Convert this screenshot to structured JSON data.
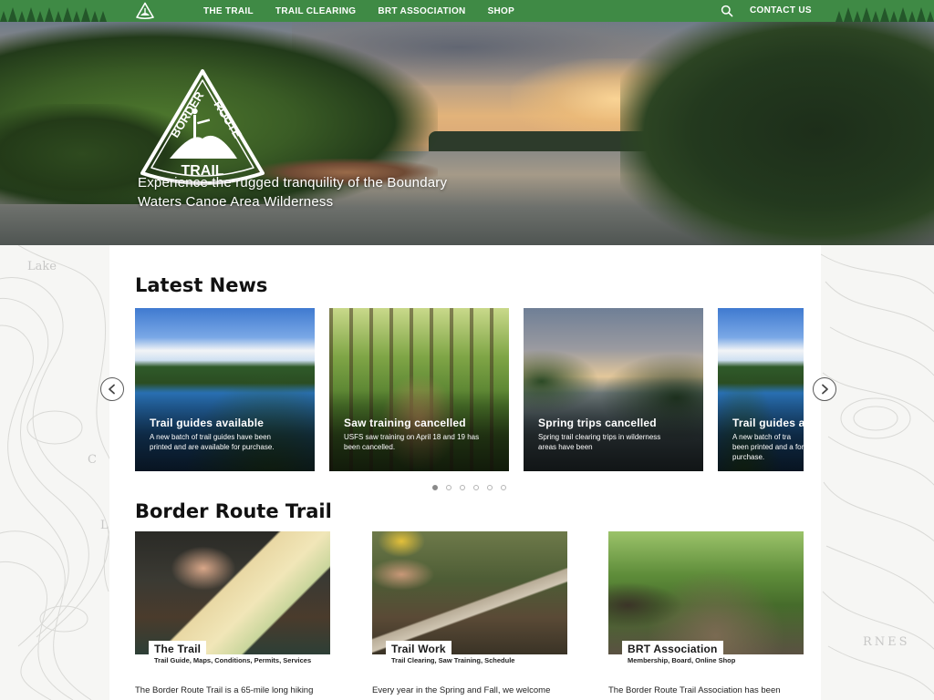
{
  "nav": {
    "links": [
      "THE TRAIL",
      "TRAIL CLEARING",
      "BRT ASSOCIATION",
      "SHOP"
    ],
    "contact": "CONTACT US",
    "search_icon": "search-icon",
    "logo_icon": "brt-triangle-logo-icon"
  },
  "hero": {
    "logo_words": [
      "BORDER",
      "ROUTE",
      "TRAIL"
    ],
    "tagline": "Experience the rugged tranquility of the Boundary Waters Canoe Area Wilderness"
  },
  "latest_news": {
    "title": "Latest News",
    "cards": [
      {
        "title": "Trail guides available",
        "desc": "A new batch of trail guides have been printed and are available for purchase."
      },
      {
        "title": "Saw training cancelled",
        "desc": "USFS saw training on April 18 and 19 has been cancelled."
      },
      {
        "title": "Spring trips cancelled",
        "desc": "Spring trail clearing trips in wilderness areas have been"
      },
      {
        "title": "Trail guides a",
        "desc": "A new batch of tra been printed and a for purchase."
      }
    ],
    "prev_icon": "chevron-left-icon",
    "next_icon": "chevron-right-icon",
    "dots": 6,
    "active_dot": 1
  },
  "brt": {
    "title": "Border Route Trail",
    "cards": [
      {
        "label": "The Trail",
        "sub": "Trail Guide, Maps, Conditions, Permits, Services",
        "text": "The Border Route Trail is a 65-mile long hiking"
      },
      {
        "label": "Trail Work",
        "sub": "Trail Clearing, Saw Training, Schedule",
        "text": "Every year in the Spring and Fall, we welcome"
      },
      {
        "label": "BRT Association",
        "sub": "Membership, Board, Online Shop",
        "text": "The Border Route Trail Association has been"
      }
    ]
  },
  "map_background": {
    "words": [
      "Lake",
      "C",
      "L",
      "RNES"
    ]
  },
  "colors": {
    "nav_green": "#3f8a45",
    "tree_dark": "#24572a"
  }
}
